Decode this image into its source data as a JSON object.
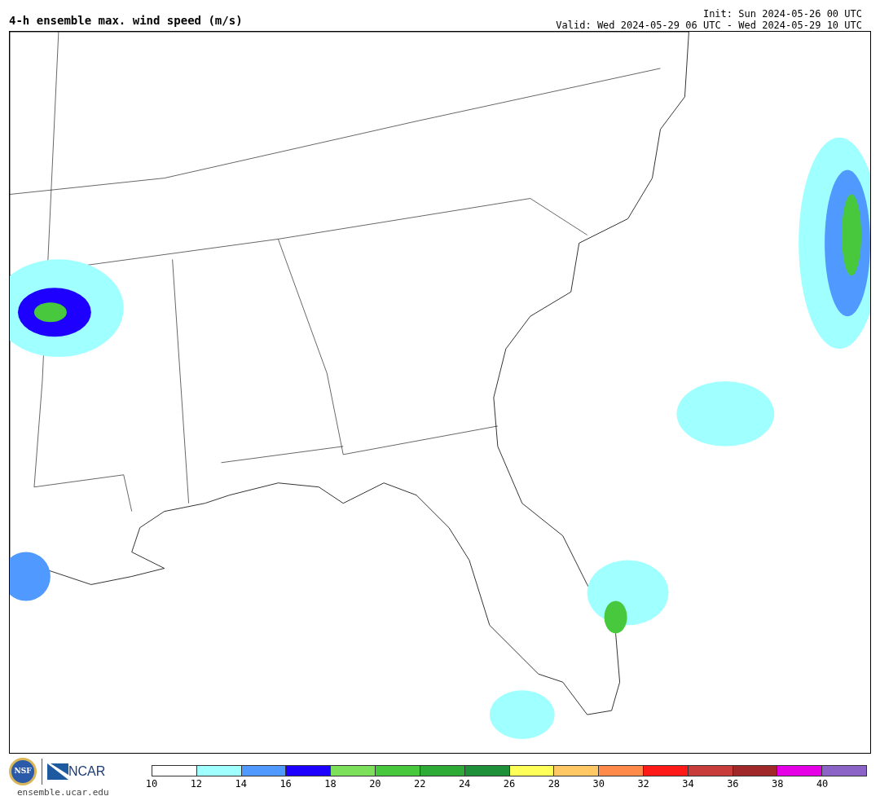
{
  "title": "4-h ensemble max. wind speed (m/s)",
  "init": "Init: Sun 2024-05-26 00 UTC",
  "valid": "Valid: Wed 2024-05-29 06 UTC - Wed 2024-05-29 10 UTC",
  "logos": {
    "nsf": "NSF",
    "ncar": "NCAR"
  },
  "site": "ensemble.ucar.edu",
  "colorbar": [
    {
      "label": "10",
      "color": "#ffffff"
    },
    {
      "label": "12",
      "color": "#a0ffff"
    },
    {
      "label": "14",
      "color": "#5099ff"
    },
    {
      "label": "16",
      "color": "#1e00ff"
    },
    {
      "label": "18",
      "color": "#7ce05a"
    },
    {
      "label": "20",
      "color": "#48c83c"
    },
    {
      "label": "22",
      "color": "#2eaa36"
    },
    {
      "label": "24",
      "color": "#1e903a"
    },
    {
      "label": "26",
      "color": "#ffff5a"
    },
    {
      "label": "28",
      "color": "#ffc864"
    },
    {
      "label": "30",
      "color": "#ff8a4a"
    },
    {
      "label": "32",
      "color": "#ff1a1a"
    },
    {
      "label": "34",
      "color": "#c83c3c"
    },
    {
      "label": "36",
      "color": "#a02828"
    },
    {
      "label": "38",
      "color": "#e600e6"
    },
    {
      "label": "40",
      "color": "#8c64c8"
    }
  ]
}
